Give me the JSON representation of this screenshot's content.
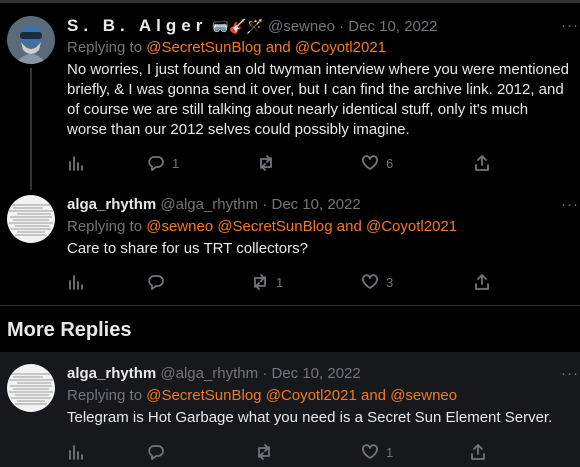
{
  "tweets": [
    {
      "name": "S. B. Alger",
      "emoji": "🥽🎸🪄",
      "handle": "@sewneo",
      "sep": "·",
      "date": "Dec 10, 2022",
      "replying_prefix": "Replying to",
      "replying_mentions": [
        "@SecretSunBlog",
        "and",
        "@Coyotl2021"
      ],
      "text": "No worries, I just found an old twyman interview where you were mentioned briefly, & I was gonna send it over, but I can find the archive link. 2012, and of course we are still talking about nearly identical stuff, only it's much worse than our 2012 selves could possibly imagine.",
      "replies": "1",
      "retweets": "",
      "likes": "6"
    },
    {
      "name": "alga_rhythm",
      "handle": "@alga_rhythm",
      "sep": "·",
      "date": "Dec 10, 2022",
      "replying_prefix": "Replying to",
      "replying_mentions": [
        "@sewneo",
        "@SecretSunBlog",
        "and",
        "@Coyotl2021"
      ],
      "text": "Care to share for us TRT collectors?",
      "replies": "",
      "retweets": "1",
      "likes": "3"
    },
    {
      "name": "alga_rhythm",
      "handle": "@alga_rhythm",
      "sep": "·",
      "date": "Dec 10, 2022",
      "replying_prefix": "Replying to",
      "replying_mentions": [
        "@SecretSunBlog",
        "@Coyotl2021",
        "and",
        "@sewneo"
      ],
      "text": "Telegram is Hot Garbage what you need is a Secret Sun Element Server.",
      "replies": "",
      "retweets": "",
      "likes": "1"
    }
  ],
  "more_label": "···",
  "section_title": "More Replies",
  "colors": {
    "background": "#000000",
    "text": "#e7e9ea",
    "muted": "#71767b",
    "mention": "#f4791f",
    "divider": "#2f3336",
    "section_band": "#16181c"
  },
  "icons": [
    "analytics-icon",
    "reply-icon",
    "retweet-icon",
    "like-icon",
    "share-icon",
    "more-icon"
  ]
}
